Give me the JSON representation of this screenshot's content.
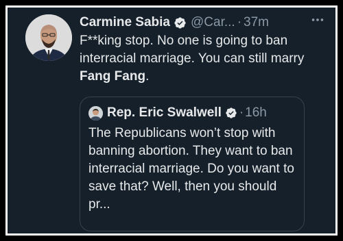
{
  "tweet": {
    "author_name": "Carmine Sabia",
    "author_handle": "@Car...",
    "separator": "·",
    "time": "37m",
    "more_icon": "more-horizontal-icon",
    "verified_icon": "verified-badge-icon",
    "text_part1": "F**king stop. No one is going to ban interracial marriage. You can still marry ",
    "text_bold": "Fang Fang",
    "text_part2": "."
  },
  "quote": {
    "author_name": "Rep. Eric Swalwell",
    "separator": "·",
    "time": "16h",
    "verified_icon": "verified-badge-icon",
    "text": "The Republicans won’t stop with banning abortion. They want to ban interracial marriage. Do you want to save that? Well, then you should pr..."
  },
  "colors": {
    "background": "#15202b",
    "text_primary": "#e7e9ea",
    "text_secondary": "#8b98a5",
    "verified_blue": "#1d9bf0",
    "border": "#38444d",
    "frame": "#ffffff"
  }
}
